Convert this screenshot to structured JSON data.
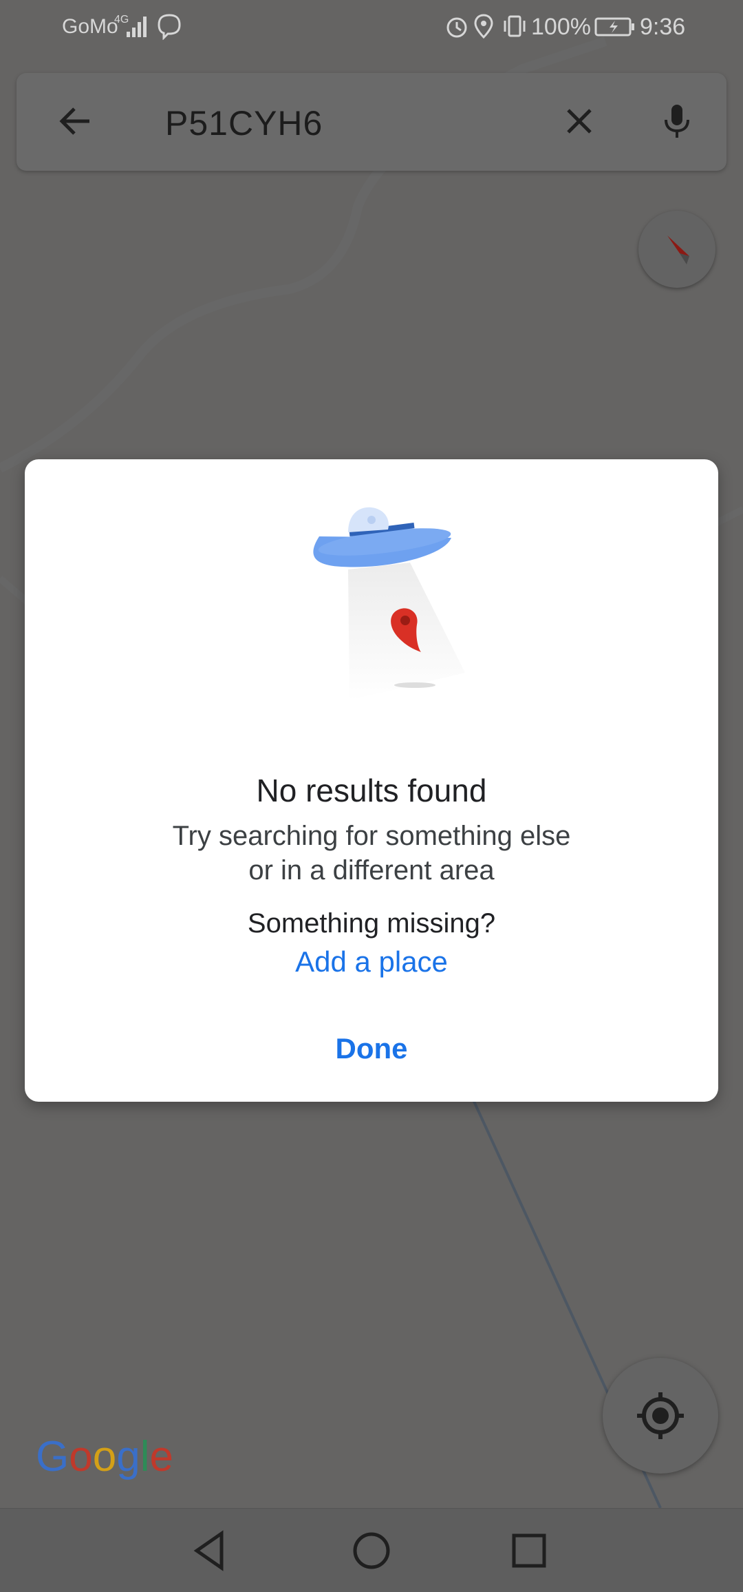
{
  "status_bar": {
    "carrier": "GoMo",
    "network": "4G",
    "battery": "100%",
    "time": "9:36"
  },
  "search": {
    "query": "P51CYH6"
  },
  "dialog": {
    "title": "No results found",
    "message_line1": "Try searching for something else",
    "message_line2": "or in a different area",
    "missing_prompt": "Something missing?",
    "add_place": "Add a place",
    "done": "Done"
  },
  "map": {
    "logo": "Google"
  },
  "colors": {
    "accent": "#1a73e8",
    "scrim": "#595959",
    "pin": "#d93025"
  },
  "icons": {
    "back": "arrow-left-icon",
    "clear": "close-icon",
    "voice": "microphone-icon",
    "compass": "compass-icon",
    "location": "my-location-icon",
    "nav_back": "triangle-back-icon",
    "nav_home": "circle-home-icon",
    "nav_recents": "square-recents-icon"
  }
}
